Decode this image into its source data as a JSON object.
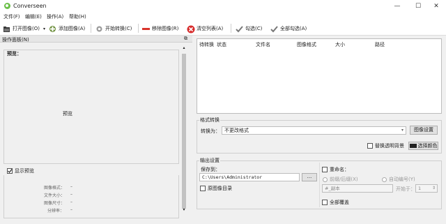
{
  "window": {
    "title": "Converseen",
    "minimize": "—",
    "maximize": "☐",
    "close": "✕"
  },
  "menu": [
    "文件(F)",
    "编辑(E)",
    "操作(A)",
    "帮助(H)"
  ],
  "toolbar": {
    "open_images": "打开图像(O)",
    "add_images": "添加图像(A)",
    "start_convert": "开始转换(C)",
    "remove_images": "移除图像(R)",
    "clear_list": "清空列表(A)",
    "check": "勾选(C)",
    "check_all": "全部勾选(A)"
  },
  "left_panel": {
    "header": "操作面板(N)",
    "preview_title": "预览：",
    "preview_placeholder": "预览",
    "show_preview": "显示预览",
    "info": {
      "format_label": "图像格式：",
      "format_value": "–",
      "size_label": "文件大小：",
      "size_value": "–",
      "dimensions_label": "图像尺寸：",
      "dimensions_value": "–",
      "resolution_label": "分辨率：",
      "resolution_value": "–"
    }
  },
  "file_list": {
    "columns": [
      "待转换",
      "状态",
      "文件名",
      "图像格式",
      "大小",
      "路径"
    ]
  },
  "format_convert": {
    "section": "格式转换",
    "convert_to_label": "转换为：",
    "convert_to_value": "不更改格式",
    "image_settings": "图像设置",
    "replace_transparent": "替换透明背景",
    "choose_color": "选择颜色"
  },
  "output": {
    "section": "输出设置",
    "save_to_label": "保存到：",
    "save_path": "C:\\Users\\Administrator",
    "browse": "...",
    "original_dir": "原图像目录",
    "rename": "重命名：",
    "prefix_suffix": "前缀/后缀(X)",
    "auto_number": "自动编号(Y)",
    "suffix_value": "#_副本",
    "start_from_label": "开始于：",
    "start_from_value": "1",
    "overwrite_all": "全部覆盖"
  },
  "colors": {
    "accent_green": "#6cc04a",
    "remove_red": "#d9342b",
    "clear_red": "#d72b2b"
  }
}
